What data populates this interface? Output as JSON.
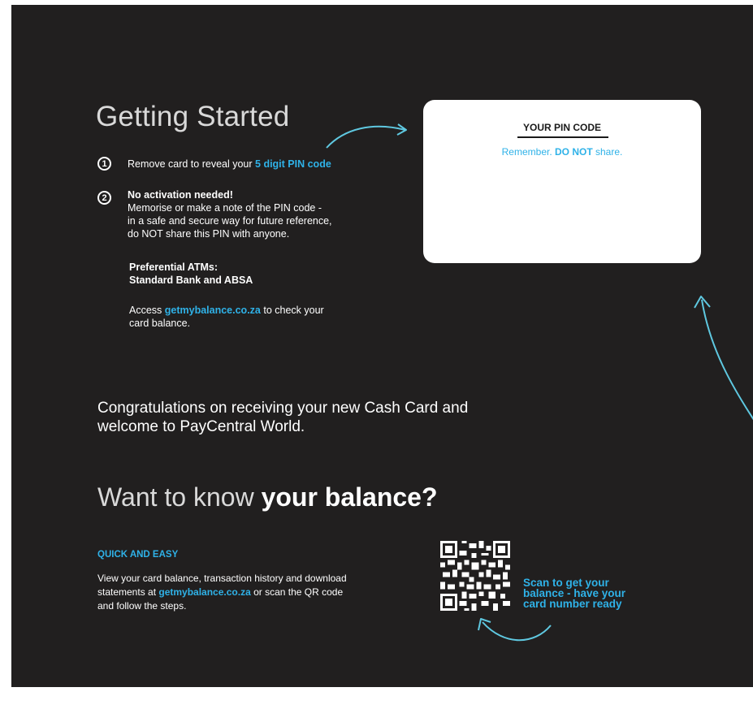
{
  "getting_started": {
    "title": "Getting Started",
    "step1": {
      "num": "1",
      "text_pre": "Remove card to reveal your ",
      "text_highlight": "5 digit PIN code"
    },
    "step2": {
      "num": "2",
      "heading": "No activation needed!",
      "line1": "Memorise or make a note of the PIN code -",
      "line2": "in a safe and secure way for future reference,",
      "line3": "do NOT share this PIN with anyone."
    },
    "atms": {
      "label": "Preferential ATMs:",
      "banks": "Standard Bank and ABSA"
    },
    "access": {
      "pre": "Access ",
      "link": "getmybalance.co.za",
      "post": " to check your",
      "line2": "card balance."
    }
  },
  "pin_card": {
    "title": "YOUR PIN CODE",
    "note_pre": "Remember. ",
    "note_bold": "DO NOT",
    "note_post": " share."
  },
  "congrats": {
    "line1": "Congratulations on receiving your new Cash Card and",
    "line2": "welcome to PayCentral World."
  },
  "balance": {
    "title_light": "Want to know ",
    "title_bold": "your balance?",
    "quick": "QUICK AND EASY",
    "desc_line1": "View your card balance, transaction history and download",
    "desc_pre": "statements at ",
    "desc_link": "getmybalance.co.za",
    "desc_post": " or scan the QR code",
    "desc_line3": "and follow the steps.",
    "scan_line1": "Scan to get your",
    "scan_line2": "balance - have your",
    "scan_line3": "card number ready"
  },
  "colors": {
    "background": "#211f1f",
    "accent": "#2fb2e8",
    "text": "#ffffff"
  },
  "icons": {
    "qr": "qr-code-icon",
    "arrow": "curved-arrow-icon"
  }
}
